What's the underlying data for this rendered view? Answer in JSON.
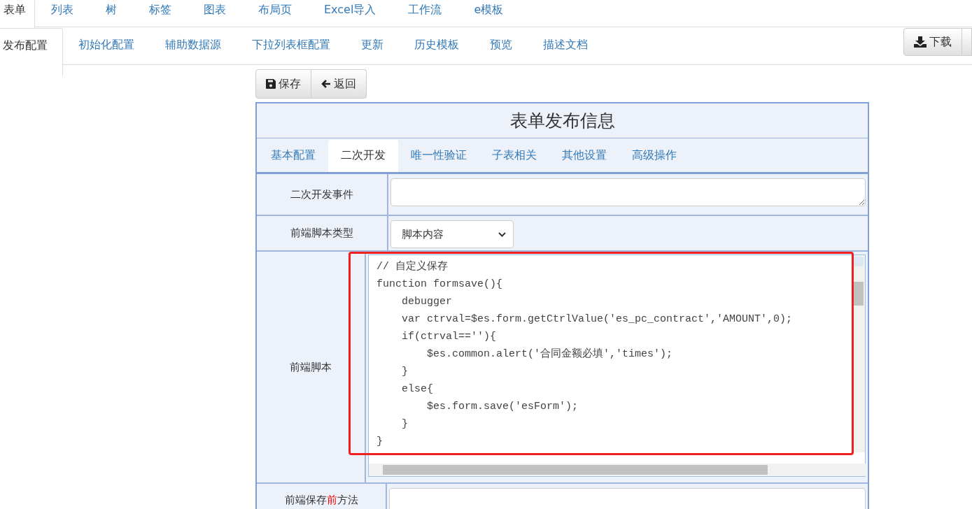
{
  "top_tabs": [
    {
      "label": "表单",
      "selected": true
    },
    {
      "label": "列表",
      "selected": false
    },
    {
      "label": "树",
      "selected": false
    },
    {
      "label": "标签",
      "selected": false
    },
    {
      "label": "图表",
      "selected": false
    },
    {
      "label": "布局页",
      "selected": false
    },
    {
      "label": "Excel导入",
      "selected": false
    },
    {
      "label": "工作流",
      "selected": false
    },
    {
      "label": "e模板",
      "selected": false
    }
  ],
  "sub_tabs": [
    {
      "label": "发布配置",
      "selected": true
    },
    {
      "label": "初始化配置",
      "selected": false
    },
    {
      "label": "辅助数据源",
      "selected": false
    },
    {
      "label": "下拉列表框配置",
      "selected": false
    },
    {
      "label": "更新",
      "selected": false
    },
    {
      "label": "历史模板",
      "selected": false
    },
    {
      "label": "预览",
      "selected": false
    },
    {
      "label": "描述文档",
      "selected": false
    }
  ],
  "download_button": "下载",
  "toolbar": {
    "save": "保存",
    "back": "返回"
  },
  "panel": {
    "title": "表单发布信息",
    "tabs": [
      {
        "label": "基本配置",
        "selected": false
      },
      {
        "label": "二次开发",
        "selected": true
      },
      {
        "label": "唯一性验证",
        "selected": false
      },
      {
        "label": "子表相关",
        "selected": false
      },
      {
        "label": "其他设置",
        "selected": false
      },
      {
        "label": "高级操作",
        "selected": false
      }
    ],
    "rows": [
      {
        "kind": "textarea",
        "label": [
          {
            "text": "二次开发事件",
            "highlight": false
          }
        ]
      },
      {
        "kind": "select",
        "label": [
          {
            "text": "前端脚本类型",
            "highlight": false
          }
        ],
        "value": "脚本内容"
      },
      {
        "kind": "code",
        "label": [
          {
            "text": "前端脚本",
            "highlight": false
          }
        ],
        "code": [
          "// 自定义保存",
          "function formsave(){",
          "    debugger",
          "    var ctrval=$es.form.getCtrlValue('es_pc_contract','AMOUNT',0);",
          "    if(ctrval==''){",
          "        $es.common.alert('合同金额必填','times');",
          "    }",
          "    else{",
          "        $es.form.save('esForm');",
          "    }",
          "}"
        ]
      },
      {
        "kind": "textarea",
        "label": [
          {
            "text": "前端保存",
            "highlight": false
          },
          {
            "text": "前",
            "highlight": true
          },
          {
            "text": "方法",
            "highlight": false
          }
        ]
      }
    ]
  }
}
